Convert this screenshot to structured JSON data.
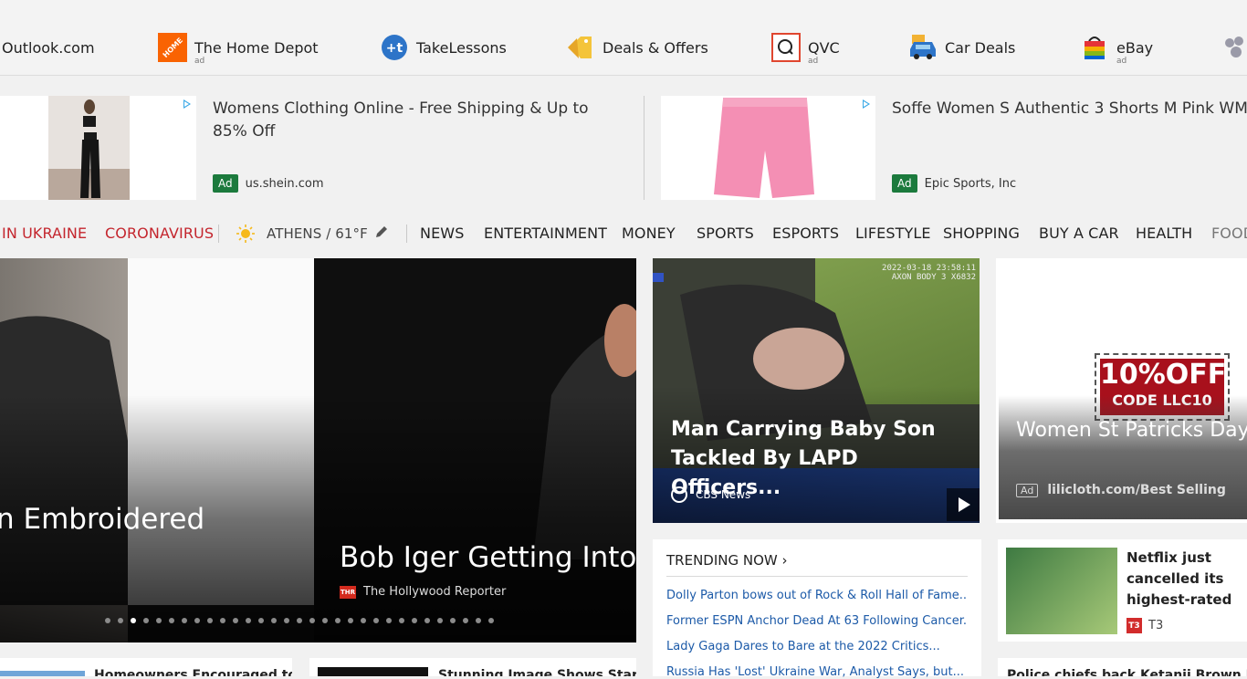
{
  "top_sites": [
    {
      "name": "Outlook.com",
      "icon": "outlook-icon",
      "ad": ""
    },
    {
      "name": "The Home Depot",
      "icon": "home-depot-logo-icon",
      "ad": "ad"
    },
    {
      "name": "TakeLessons",
      "icon": "takelessons-logo-icon",
      "ad": ""
    },
    {
      "name": "Deals & Offers",
      "icon": "price-tag-icon",
      "ad": ""
    },
    {
      "name": "QVC",
      "icon": "qvc-logo-icon",
      "ad": "ad"
    },
    {
      "name": "Car Deals",
      "icon": "car-icon",
      "ad": ""
    },
    {
      "name": "eBay",
      "icon": "shopping-bag-icon",
      "ad": "ad"
    }
  ],
  "ads": [
    {
      "title": "Womens Clothing Online - Free Shipping & Up to 85% Off",
      "badge": "Ad",
      "source": "us.shein.com"
    },
    {
      "title": "Soffe Women S Authentic 3 Shorts M Pink WM",
      "badge": "Ad",
      "source": "Epic Sports, Inc"
    }
  ],
  "nav": {
    "items": [
      "IN UKRAINE",
      "CORONAVIRUS",
      "NEWS",
      "ENTERTAINMENT",
      "MONEY",
      "SPORTS",
      "ESPORTS",
      "LIFESTYLE",
      "SHOPPING",
      "BUY A CAR",
      "HEALTH",
      "FOOD"
    ],
    "weather": "ATHENS / 61°F",
    "accent_color": "#c4262e"
  },
  "carousel": {
    "slide_a_caption": "n Embroidered",
    "slide_b_caption": "Bob Iger Getting Into the",
    "slide_b_source": "The Hollywood Reporter",
    "slide_b_source_logo": "THR",
    "dot_count": 31,
    "active_dot": 2
  },
  "video": {
    "title": "Man Carrying Baby Son Tackled By LAPD Officers...",
    "source": "CBS News",
    "timestamp": "2022-03-18 23:58:11\nAXON BODY 3 X6832"
  },
  "promo": {
    "coupon_big": "10%OFF",
    "coupon_code": "CODE LLC10",
    "title": "Women St Patricks Day - Funny T-shirt&Sweatshirt",
    "badge": "Ad",
    "source": "lilicloth.com/Best Selling"
  },
  "trending": {
    "heading": "TRENDING NOW ›",
    "links": [
      "Dolly Parton bows out of Rock & Roll Hall of Fame...",
      "Former ESPN Anchor Dead At 63 Following Cancer...",
      "Lady Gaga Dares to Bare at the 2022 Critics...",
      "Russia Has 'Lost' Ukraine War, Analyst Says, but..."
    ]
  },
  "news_card": {
    "title": "Netflix just cancelled its highest-rated show — Netflix curse strikes",
    "source": "T3",
    "source_logo": "T3"
  },
  "bottom_cards": [
    "Homeowners Encouraged to",
    "Stunning Image Shows Star",
    "Police chiefs back Ketanji Brown Jackson"
  ]
}
